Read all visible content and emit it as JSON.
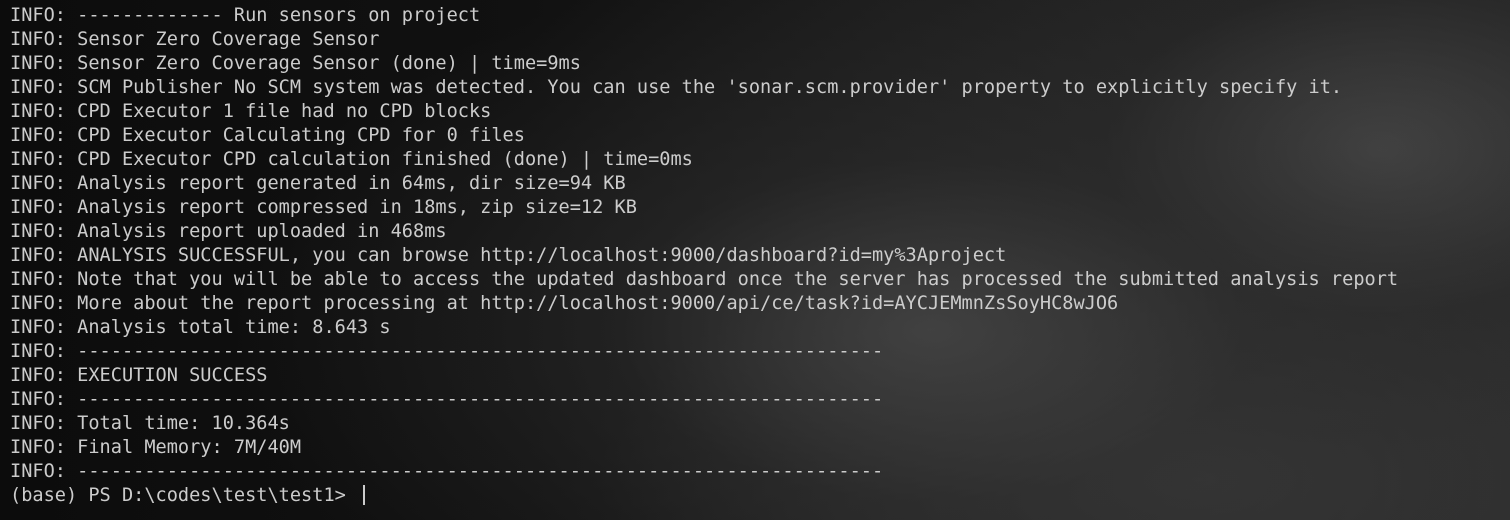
{
  "terminal": {
    "lines": [
      "INFO: ------------- Run sensors on project",
      "INFO: Sensor Zero Coverage Sensor",
      "INFO: Sensor Zero Coverage Sensor (done) | time=9ms",
      "INFO: SCM Publisher No SCM system was detected. You can use the 'sonar.scm.provider' property to explicitly specify it.",
      "INFO: CPD Executor 1 file had no CPD blocks",
      "INFO: CPD Executor Calculating CPD for 0 files",
      "INFO: CPD Executor CPD calculation finished (done) | time=0ms",
      "INFO: Analysis report generated in 64ms, dir size=94 KB",
      "INFO: Analysis report compressed in 18ms, zip size=12 KB",
      "INFO: Analysis report uploaded in 468ms",
      "INFO: ANALYSIS SUCCESSFUL, you can browse http://localhost:9000/dashboard?id=my%3Aproject",
      "INFO: Note that you will be able to access the updated dashboard once the server has processed the submitted analysis report",
      "INFO: More about the report processing at http://localhost:9000/api/ce/task?id=AYCJEMmnZsSoyHC8wJO6",
      "INFO: Analysis total time: 8.643 s",
      "INFO: ------------------------------------------------------------------------",
      "INFO: EXECUTION SUCCESS",
      "INFO: ------------------------------------------------------------------------",
      "INFO: Total time: 10.364s",
      "INFO: Final Memory: 7M/40M",
      "INFO: ------------------------------------------------------------------------"
    ],
    "prompt": "(base) PS D:\\codes\\test\\test1> ",
    "input_value": ""
  },
  "colors": {
    "text": "#cccccc",
    "background": "#0c0c0c"
  }
}
